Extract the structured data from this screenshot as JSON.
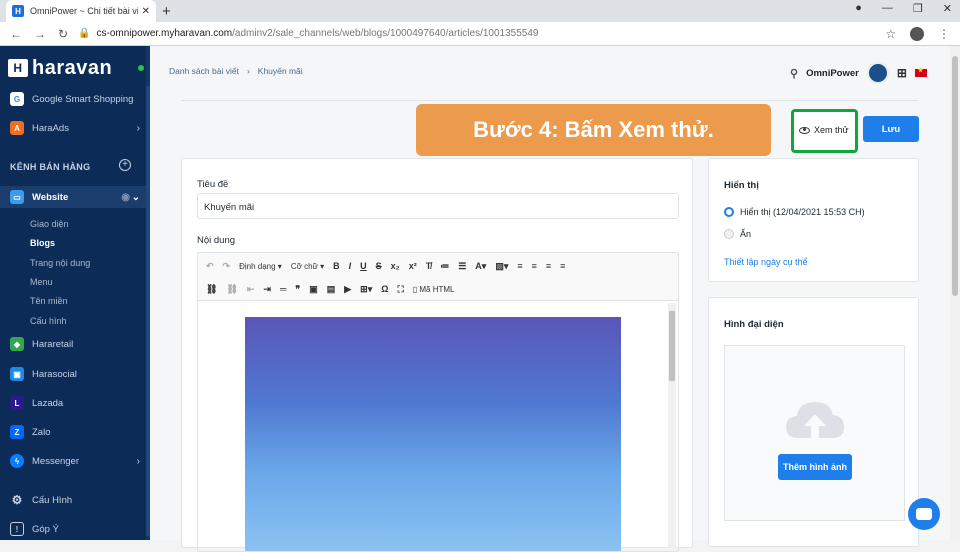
{
  "browser": {
    "tab_title": "OmniPower ~ Chi tiết bài viết ~ G",
    "favicon": "H",
    "url_host": "cs-omnipower.myharavan.com",
    "url_path": "/adminv2/sale_channels/web/blogs/1000497640/articles/1001355549"
  },
  "sidebar": {
    "logo": "haravan",
    "top_items": [
      {
        "label": "Google Smart Shopping",
        "icon": "google-icon"
      },
      {
        "label": "HaraAds",
        "icon": "haraads-icon"
      }
    ],
    "section_title": "KÊNH BÁN HÀNG",
    "website_label": "Website",
    "website_sub": [
      "Giao diện",
      "Blogs",
      "Trang nội dung",
      "Menu",
      "Tên miền",
      "Cấu hình"
    ],
    "channels": [
      {
        "label": "Hararetail",
        "icon": "hararetail-icon",
        "color": "#2fa84f"
      },
      {
        "label": "Harasocial",
        "icon": "harasocial-icon",
        "color": "#1e88e5"
      },
      {
        "label": "Lazada",
        "icon": "lazada-icon",
        "color": "#2a1a8a"
      },
      {
        "label": "Zalo",
        "icon": "zalo-icon",
        "color": "#0068ff"
      },
      {
        "label": "Messenger",
        "icon": "messenger-icon",
        "color": "#0a7cff"
      }
    ],
    "bottom_items": [
      {
        "label": "Cấu Hình",
        "icon": "gear-icon"
      },
      {
        "label": "Góp Ý",
        "icon": "feedback-icon"
      }
    ]
  },
  "header": {
    "breadcrumb_1": "Danh sách bài viết",
    "breadcrumb_sep": "›",
    "breadcrumb_2": "Khuyến mãi",
    "shop_name": "OmniPower"
  },
  "callout": "Bước 4: Bấm Xem thử.",
  "actions": {
    "preview": "Xem thử",
    "save": "Lưu"
  },
  "form": {
    "title_label": "Tiêu đề",
    "title_value": "Khuyến mãi",
    "content_label": "Nội dung",
    "toolbar_format": "Định dạng",
    "toolbar_font": "Cỡ chữ",
    "toolbar_html": "Mã HTML"
  },
  "visibility": {
    "title": "Hiển thị",
    "option_shown": "Hiển thị (12/04/2021 15:53 CH)",
    "option_hidden": "Ẩn",
    "schedule_link": "Thiết lập ngày cụ thể"
  },
  "thumbnail": {
    "title": "Hình đại diện",
    "add_button": "Thêm hình ảnh"
  },
  "colors": {
    "sidebar": "#0c2b57",
    "accent": "#1e7fea",
    "callout": "#ec9a4c",
    "highlight": "#12a53c"
  }
}
